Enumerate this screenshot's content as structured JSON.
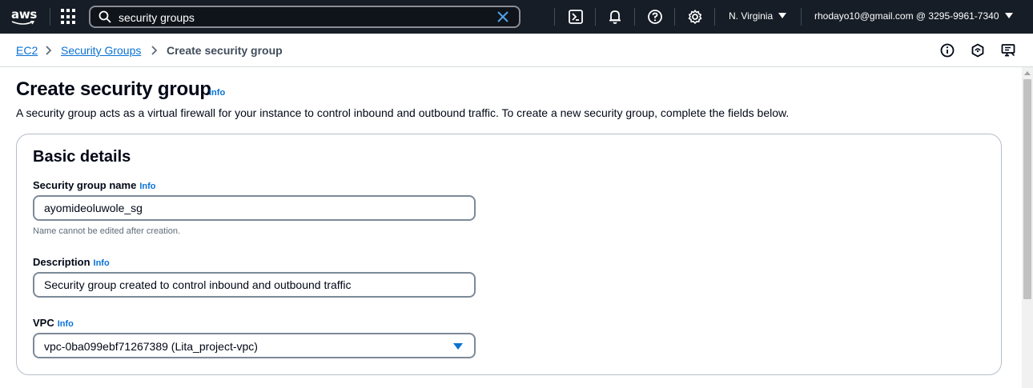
{
  "topnav": {
    "logo_text": "aws",
    "search": {
      "value": "security groups",
      "placeholder": ""
    },
    "region": "N. Virginia",
    "account": "rhodayo10@gmail.com @ 3295-9961-7340"
  },
  "breadcrumb": {
    "items": [
      {
        "label": "EC2"
      },
      {
        "label": "Security Groups"
      },
      {
        "label": "Create security group"
      }
    ]
  },
  "page": {
    "title": "Create security group",
    "title_info": "Info",
    "description": "A security group acts as a virtual firewall for your instance to control inbound and outbound traffic. To create a new security group, complete the fields below."
  },
  "basic_details": {
    "title": "Basic details",
    "name_field": {
      "label": "Security group name",
      "info": "Info",
      "value": "ayomideoluwole_sg",
      "hint": "Name cannot be edited after creation."
    },
    "description_field": {
      "label": "Description",
      "info": "Info",
      "value": "Security group created to control inbound and outbound traffic"
    },
    "vpc_field": {
      "label": "VPC",
      "info": "Info",
      "value": "vpc-0ba099ebf71267389 (Lita_project-vpc)"
    }
  },
  "colors": {
    "nav_bg": "#161d26",
    "link": "#0972d3",
    "text": "#000716",
    "border": "#7d8998"
  },
  "icons": [
    "search-icon",
    "clear-icon",
    "apps-grid-icon",
    "cloudshell-icon",
    "bell-icon",
    "help-icon",
    "gear-icon",
    "chevron-right-icon",
    "info-circle-icon",
    "feedback-icon",
    "chevron-down-icon"
  ]
}
